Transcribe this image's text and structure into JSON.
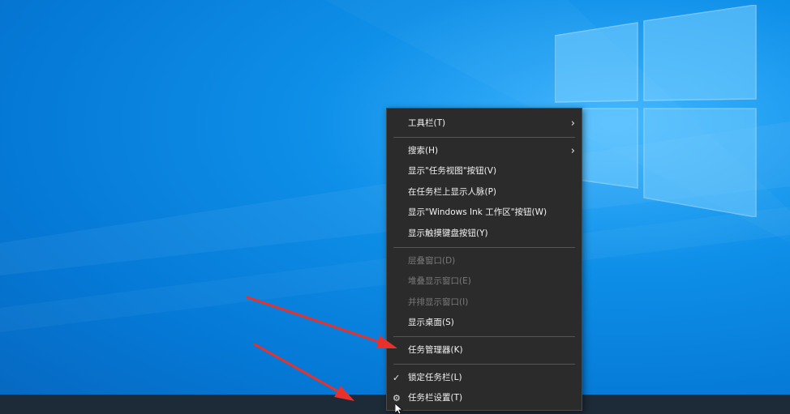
{
  "colors": {
    "menu_bg": "#2b2b2b",
    "menu_text": "#f2f2f2",
    "menu_disabled": "#7a7a7a",
    "taskbar": "#1d2a38",
    "arrow": "#e8312b"
  },
  "context_menu": {
    "toolbars": "工具栏(T)",
    "search": "搜索(H)",
    "show_task_view": "显示\"任务视图\"按钮(V)",
    "show_people": "在任务栏上显示人脉(P)",
    "show_ink": "显示\"Windows Ink 工作区\"按钮(W)",
    "show_touch_keyboard": "显示触摸键盘按钮(Y)",
    "cascade": "层叠窗口(D)",
    "stacked": "堆叠显示窗口(E)",
    "side_by_side": "并排显示窗口(I)",
    "show_desktop": "显示桌面(S)",
    "task_manager": "任务管理器(K)",
    "lock_taskbar": "锁定任务栏(L)",
    "taskbar_settings": "任务栏设置(T)"
  },
  "icons": {
    "submenu": "chevron-right-icon",
    "check": "checkmark-icon",
    "settings": "gear-icon"
  }
}
